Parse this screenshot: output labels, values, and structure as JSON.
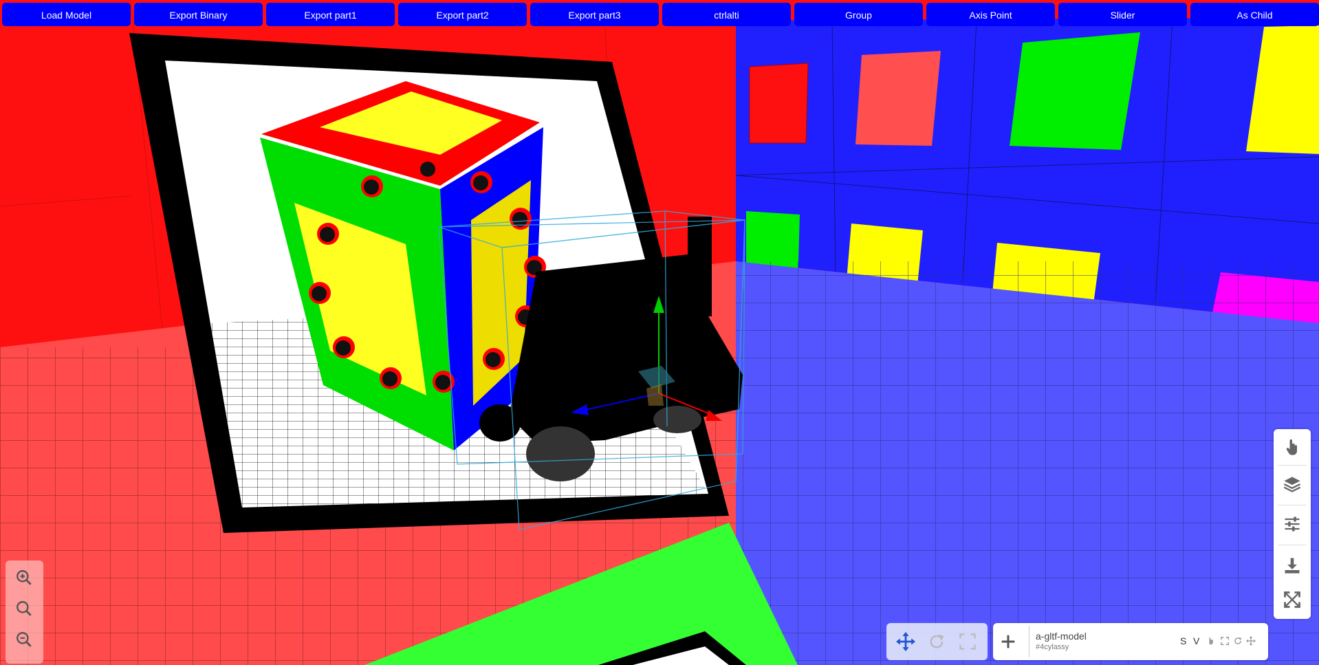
{
  "toolbar": {
    "buttons": [
      "Load Model",
      "Export Binary",
      "Export part1",
      "Export part2",
      "Export part3",
      "ctrlalti",
      "Group",
      "Axis Point",
      "Slider",
      "As Child"
    ]
  },
  "colors": {
    "toolbar_button": "#0000ff",
    "left_wall": "#ff1010",
    "right_wall": "#2020ff",
    "floor_red": "#ff4b4b",
    "floor_blue": "#5555ff",
    "floor_green": "#33ff33",
    "selection_box": "#33aadd"
  },
  "icons": {
    "zoom": [
      "zoom-in-icon",
      "zoom-reset-icon",
      "zoom-out-icon"
    ],
    "right_panel": [
      "hand-pointer-icon",
      "layers-icon",
      "sliders-icon",
      "download-icon",
      "fullscreen-icon"
    ],
    "transform": [
      "move-icon",
      "rotate-icon",
      "scale-icon"
    ],
    "model": [
      "add-icon",
      "move-icon",
      "rotate-icon",
      "expand-icon",
      "axis-icon"
    ]
  },
  "model": {
    "name": "a-gltf-model",
    "id": "#4cylassy",
    "mode_s": "S",
    "mode_v": "V"
  }
}
